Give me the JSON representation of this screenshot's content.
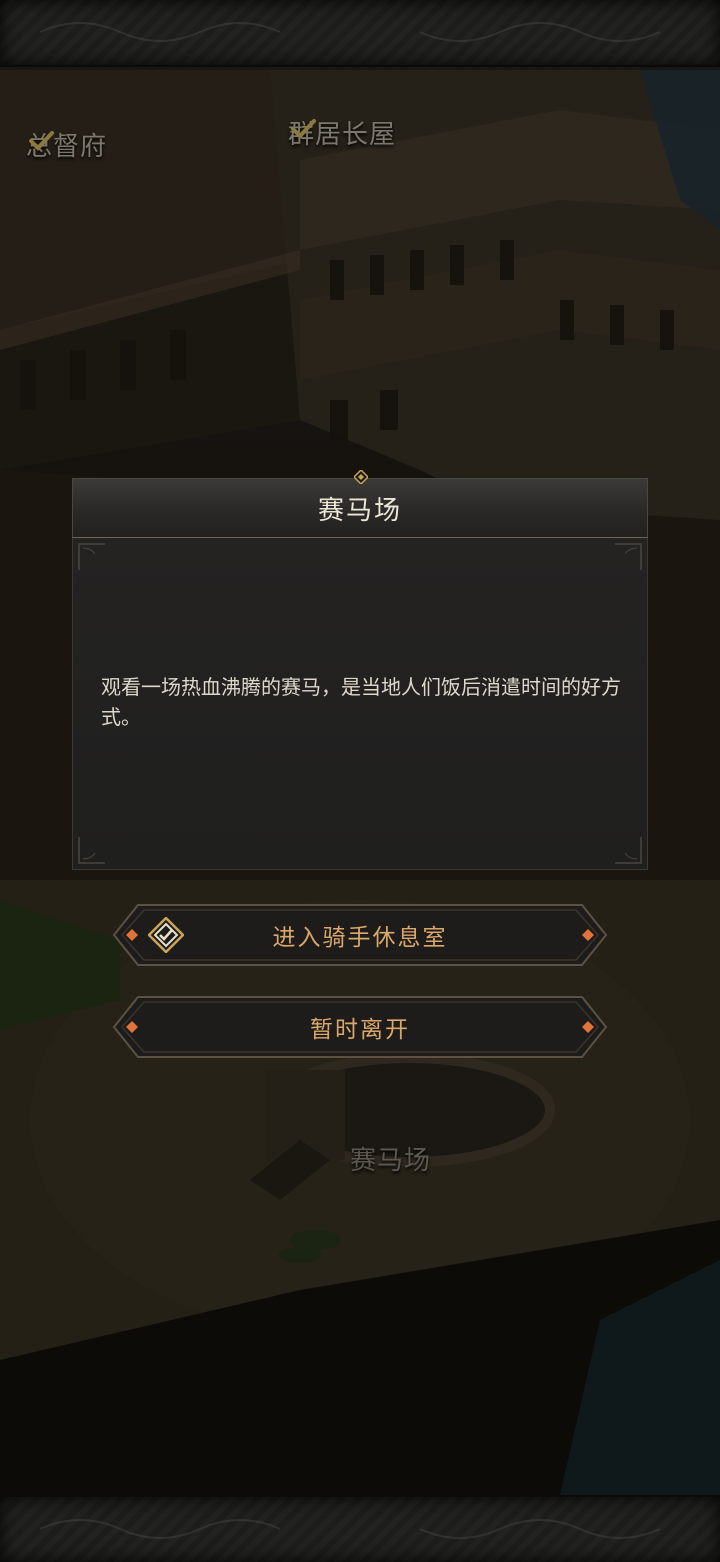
{
  "map": {
    "buildings": [
      {
        "label": "总督府",
        "completed": true
      },
      {
        "label": "群居长屋",
        "completed": true
      },
      {
        "label": "赛马场",
        "completed": false
      }
    ]
  },
  "dialog": {
    "title": "赛马场",
    "description": "观看一场热血沸腾的赛马，是当地人们饭后消遣时间的好方式。"
  },
  "actions": {
    "enter_label": "进入骑手休息室",
    "enter_icon": "rider-lounge-icon",
    "leave_label": "暂时离开"
  },
  "colors": {
    "button_text": "#d9a86a",
    "title_text": "#ece6d6",
    "accent_diamond": "#e0743a",
    "gold": "#c9a55a"
  }
}
